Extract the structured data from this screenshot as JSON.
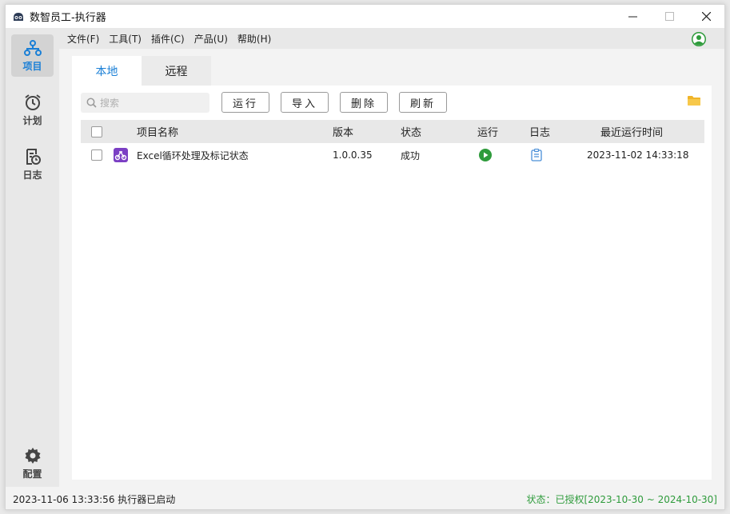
{
  "window": {
    "title": "数智员工-执行器"
  },
  "sidebar": {
    "items": [
      {
        "label": "项目",
        "icon": "project-tree-icon",
        "active": true
      },
      {
        "label": "计划",
        "icon": "alarm-clock-icon",
        "active": false
      },
      {
        "label": "日志",
        "icon": "log-clock-icon",
        "active": false
      },
      {
        "label": "配置",
        "icon": "gear-icon",
        "active": false
      }
    ]
  },
  "menubar": {
    "items": [
      "文件(F)",
      "工具(T)",
      "插件(C)",
      "产品(U)",
      "帮助(H)"
    ]
  },
  "tabs": [
    {
      "label": "本地",
      "active": true
    },
    {
      "label": "远程",
      "active": false
    }
  ],
  "toolbar": {
    "search_placeholder": "搜索",
    "run_label": "运行",
    "import_label": "导入",
    "delete_label": "删除",
    "refresh_label": "刷新"
  },
  "table": {
    "headers": {
      "name": "项目名称",
      "version": "版本",
      "status": "状态",
      "run": "运行",
      "log": "日志",
      "last_run": "最近运行时间"
    },
    "rows": [
      {
        "name": "Excel循环处理及标记状态",
        "version": "1.0.0.35",
        "status": "成功",
        "last_run": "2023-11-02 14:33:18"
      }
    ]
  },
  "statusbar": {
    "left": "2023-11-06 13:33:56 执行器已启动",
    "right": "状态：已授权[2023-10-30 ~ 2024-10-30]"
  },
  "colors": {
    "accent": "#1a7fd6",
    "success": "#2e9b3b",
    "project_icon": "#7b3fc4",
    "folder": "#f0b429"
  }
}
